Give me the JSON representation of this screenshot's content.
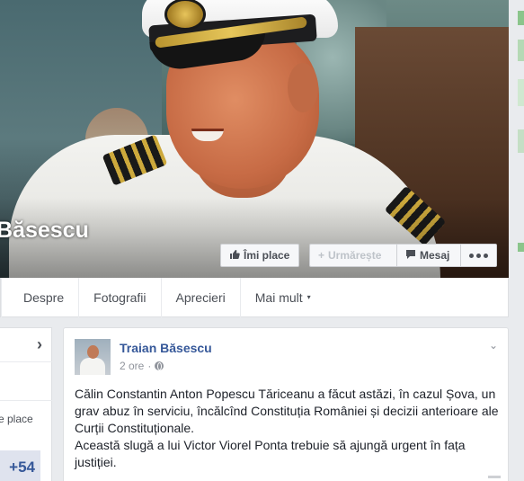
{
  "cover": {
    "page_name": "Băsescu",
    "buttons": {
      "like": {
        "label": "Îmi place",
        "icon": "thumbs-up-icon"
      },
      "follow": {
        "label": "Urmărește",
        "icon": "plus-icon"
      },
      "message": {
        "label": "Mesaj",
        "icon": "message-bubble-icon"
      },
      "more": {
        "icon": "more-dots-icon"
      }
    }
  },
  "nav": {
    "tabs": [
      {
        "label": "Despre"
      },
      {
        "label": "Fotografii"
      },
      {
        "label": "Aprecieri"
      },
      {
        "label": "Mai mult",
        "caret": "▾"
      }
    ]
  },
  "left_card": {
    "chevron": "›",
    "place_text": "e place",
    "count": "+54"
  },
  "post": {
    "author": "Traian Băsescu",
    "time": "2 ore",
    "separator": "·",
    "chevron": "⌄",
    "paragraph_1": "Călin Constantin Anton Popescu Tăriceanu a făcut astăzi, în cazul Șova, un grav abuz în serviciu, încălcînd Constituția României și decizii anterioare ale Curții Constituționale.",
    "paragraph_2": "Această slugă a lui Victor Viorel Ponta trebuie să ajungă urgent în fața justiției."
  },
  "colors": {
    "link_blue": "#365899",
    "page_bg": "#e9ebee",
    "button_bg": "#f6f7f9"
  }
}
